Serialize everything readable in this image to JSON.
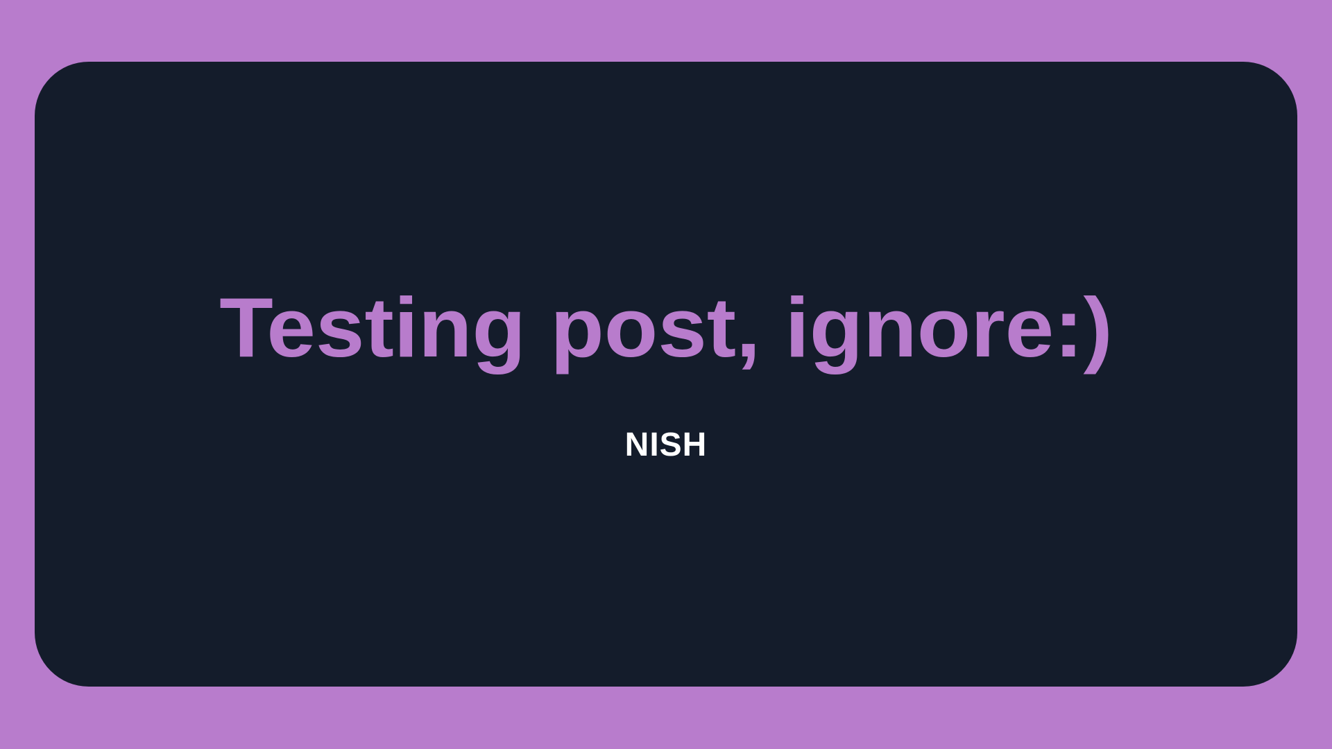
{
  "card": {
    "title": "Testing post, ignore:)",
    "author": "NISH"
  },
  "colors": {
    "background": "#b87ccc",
    "card": "#141c2b",
    "title": "#b87ccc",
    "author": "#ffffff"
  }
}
